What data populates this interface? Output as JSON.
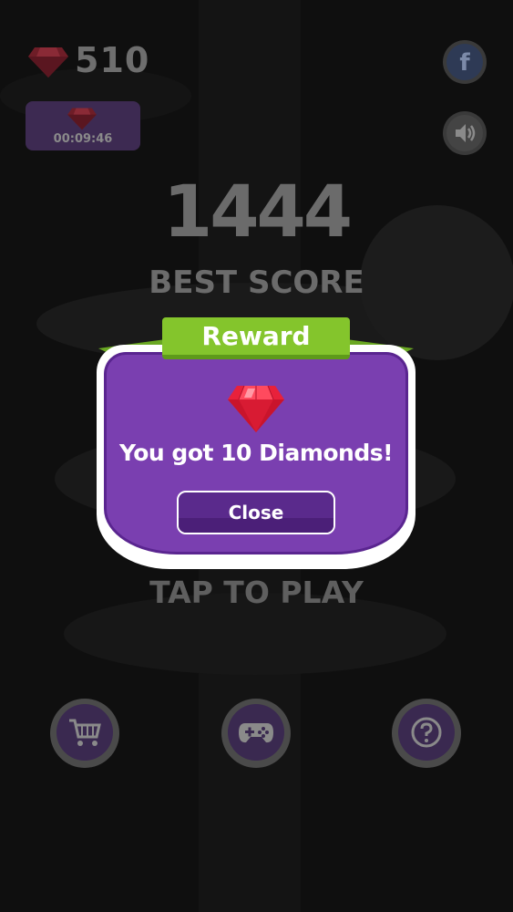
{
  "hud": {
    "gem_icon": "red-diamond-icon",
    "gem_count": "510",
    "timer_gem_icon": "red-diamond-icon",
    "timer": "00:09:46",
    "facebook_icon": "facebook-icon",
    "facebook_glyph": "f",
    "sound_icon": "speaker-icon"
  },
  "score": {
    "best_value": "1444",
    "best_label": "BEST SCORE"
  },
  "dialog": {
    "title": "Reward",
    "icon": "red-diamond-icon",
    "message": "You got 10 Diamonds!",
    "close_label": "Close"
  },
  "prompt": {
    "tap_label": "TAP TO PLAY"
  },
  "bottom_buttons": {
    "shop_icon": "shopping-cart-icon",
    "games_icon": "gamepad-icon",
    "help_icon": "question-mark-icon"
  },
  "colors": {
    "panel_purple": "#7a3fb0",
    "banner_green": "#84c52c",
    "diamond_red": "#e8213b"
  }
}
